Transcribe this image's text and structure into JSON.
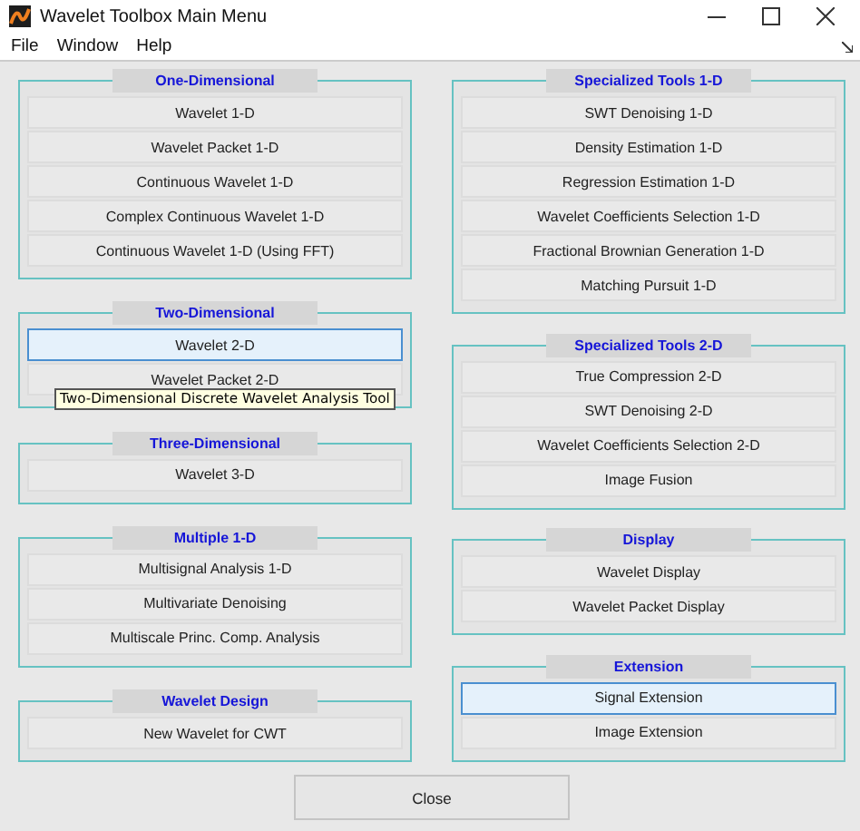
{
  "window": {
    "title": "Wavelet Toolbox Main Menu"
  },
  "menu": [
    "File",
    "Window",
    "Help"
  ],
  "columns": [
    {
      "groups": [
        {
          "title": "One-Dimensional",
          "buttons": [
            {
              "label": "Wavelet 1-D",
              "highlighted": false
            },
            {
              "label": "Wavelet Packet 1-D",
              "highlighted": false
            },
            {
              "label": "Continuous Wavelet 1-D",
              "highlighted": false
            },
            {
              "label": "Complex Continuous Wavelet 1-D",
              "highlighted": false
            },
            {
              "label": "Continuous Wavelet 1-D (Using FFT)",
              "highlighted": false
            }
          ]
        },
        {
          "title": "Two-Dimensional",
          "buttons": [
            {
              "label": "Wavelet 2-D",
              "highlighted": true
            },
            {
              "label": "Wavelet Packet 2-D",
              "highlighted": false
            }
          ]
        },
        {
          "title": "Three-Dimensional",
          "buttons": [
            {
              "label": "Wavelet 3-D",
              "highlighted": false
            }
          ]
        },
        {
          "title": "Multiple 1-D",
          "buttons": [
            {
              "label": "Multisignal Analysis 1-D",
              "highlighted": false
            },
            {
              "label": "Multivariate Denoising",
              "highlighted": false
            },
            {
              "label": "Multiscale Princ. Comp. Analysis",
              "highlighted": false
            }
          ]
        },
        {
          "title": "Wavelet Design",
          "buttons": [
            {
              "label": "New Wavelet for CWT",
              "highlighted": false
            }
          ]
        }
      ]
    },
    {
      "groups": [
        {
          "title": "Specialized Tools 1-D",
          "buttons": [
            {
              "label": "SWT Denoising 1-D",
              "highlighted": false
            },
            {
              "label": "Density Estimation 1-D",
              "highlighted": false
            },
            {
              "label": "Regression Estimation 1-D",
              "highlighted": false
            },
            {
              "label": "Wavelet Coefficients Selection 1-D",
              "highlighted": false
            },
            {
              "label": "Fractional Brownian Generation 1-D",
              "highlighted": false
            },
            {
              "label": "Matching Pursuit 1-D",
              "highlighted": false
            }
          ]
        },
        {
          "title": "Specialized Tools 2-D",
          "buttons": [
            {
              "label": "True Compression 2-D",
              "highlighted": false
            },
            {
              "label": "SWT Denoising 2-D",
              "highlighted": false
            },
            {
              "label": "Wavelet Coefficients Selection 2-D",
              "highlighted": false
            },
            {
              "label": "Image Fusion",
              "highlighted": false
            }
          ]
        },
        {
          "title": "Display",
          "buttons": [
            {
              "label": "Wavelet Display",
              "highlighted": false
            },
            {
              "label": "Wavelet Packet Display",
              "highlighted": false
            }
          ]
        },
        {
          "title": "Extension",
          "buttons": [
            {
              "label": "Signal Extension",
              "highlighted": true
            },
            {
              "label": "Image Extension",
              "highlighted": false
            }
          ]
        }
      ]
    }
  ],
  "tooltip": "Two-Dimensional Discrete Wavelet Analysis Tool",
  "close_button": "Close"
}
